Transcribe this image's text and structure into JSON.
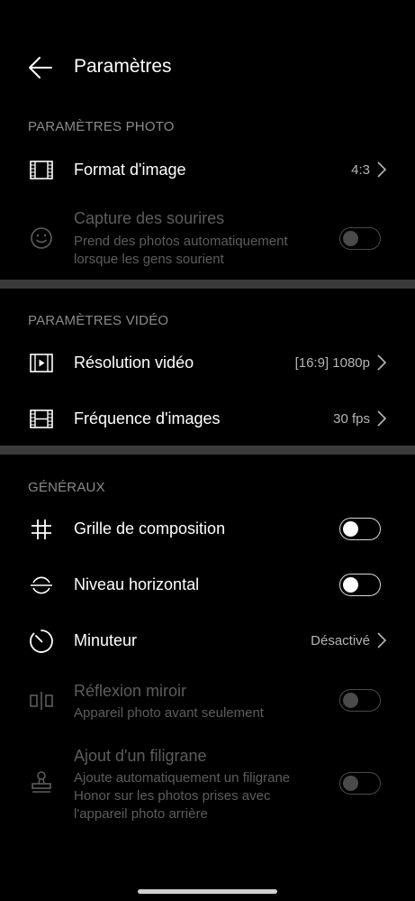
{
  "header": {
    "title": "Paramètres",
    "back_icon": "arrow-left-icon"
  },
  "sections": {
    "photo": {
      "title": "PARAMÈTRES PHOTO",
      "format": {
        "label": "Format d'image",
        "value": "4:3"
      },
      "capture": {
        "label": "Capture des sourires",
        "sub1": "Prend des photos automatiquement",
        "sub2": "lorsque les gens sourient",
        "enabled": false,
        "on": false
      }
    },
    "video": {
      "title": "PARAMÈTRES VIDÉO",
      "resolution": {
        "label": "Résolution vidéo",
        "value": "[16:9] 1080p"
      },
      "framerate": {
        "label": "Fréquence d'images",
        "value": "30 fps"
      }
    },
    "general": {
      "title": "GÉNÉRAUX",
      "grid": {
        "label": "Grille de composition",
        "on": false
      },
      "level": {
        "label": "Niveau horizontal",
        "on": false
      },
      "timer": {
        "label": "Minuteur",
        "value": "Désactivé"
      },
      "mirror": {
        "label": "Réflexion miroir",
        "sub": "Appareil photo avant seulement",
        "enabled": false,
        "on": false
      },
      "watermark": {
        "label": "Ajout d'un filigrane",
        "sub1": "Ajoute automatiquement un filigrane",
        "sub2": "Honor sur les photos prises avec",
        "sub3": "l'appareil photo arrière",
        "enabled": false,
        "on": false
      }
    }
  },
  "colors": {
    "background": "#000000",
    "divider": "#3a3a3a",
    "section_title": "#8a8a8a",
    "disabled": "#5d5d5d"
  }
}
